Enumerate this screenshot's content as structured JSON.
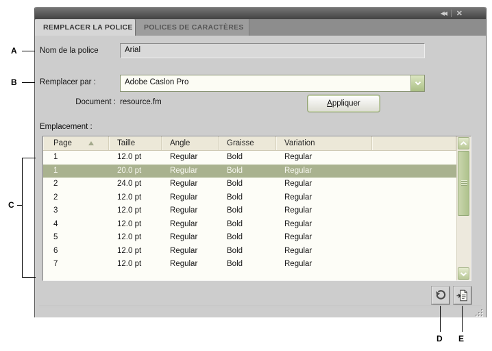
{
  "panel": {
    "titlebar": {
      "collapse_icon": "◀◀",
      "close_icon": "✕"
    },
    "tabs": [
      {
        "label": "REMPLACER LA POLICE",
        "active": true
      },
      {
        "label": "POLICES DE CARACTÈRES",
        "active": false
      }
    ],
    "form": {
      "font_name": {
        "label": "Nom de la police",
        "value": "Arial"
      },
      "replace_with": {
        "label": "Remplacer par :",
        "value": "Adobe Caslon Pro"
      },
      "document": {
        "label": "Document :",
        "value": "resource.fm"
      },
      "apply_button_label": "Appliquer",
      "location_label": "Emplacement :"
    },
    "table": {
      "columns": [
        "Page",
        "Taille",
        "Angle",
        "Graisse",
        "Variation"
      ],
      "sort": {
        "column": "Page",
        "direction": "ascending"
      },
      "selected_row_index": 1,
      "rows": [
        [
          "1",
          "12.0 pt",
          "Regular",
          "Bold",
          "Regular"
        ],
        [
          "1",
          "20.0 pt",
          "Regular",
          "Bold",
          "Regular"
        ],
        [
          "2",
          "24.0 pt",
          "Regular",
          "Bold",
          "Regular"
        ],
        [
          "2",
          "12.0 pt",
          "Regular",
          "Bold",
          "Regular"
        ],
        [
          "3",
          "12.0 pt",
          "Regular",
          "Bold",
          "Regular"
        ],
        [
          "4",
          "12.0 pt",
          "Regular",
          "Bold",
          "Regular"
        ],
        [
          "5",
          "12.0 pt",
          "Regular",
          "Bold",
          "Regular"
        ],
        [
          "6",
          "12.0 pt",
          "Regular",
          "Bold",
          "Regular"
        ],
        [
          "7",
          "12.0 pt",
          "Regular",
          "Bold",
          "Regular"
        ]
      ]
    },
    "footer_icons": [
      "refresh-icon",
      "go-to-location-icon"
    ],
    "colors": {
      "selection_green": "#a9b28f",
      "scrollbar_green": "#b7c795",
      "header_beige": "#ece8d8",
      "titlebar_dark": "#4a4a4a",
      "panel_gray": "#cdcdcd"
    }
  },
  "annotations": {
    "labels": [
      "A",
      "B",
      "C",
      "D",
      "E"
    ]
  }
}
